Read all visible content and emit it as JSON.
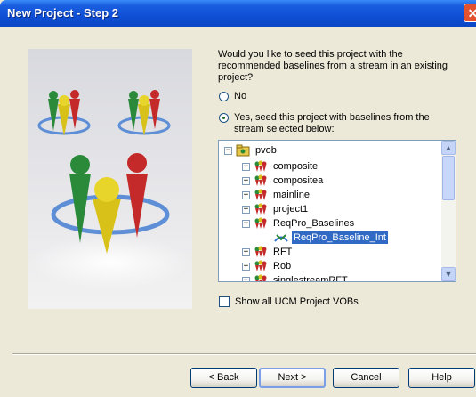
{
  "window": {
    "title": "New Project - Step 2",
    "close_glyph": "✕"
  },
  "prompt": {
    "text": "Would you like to seed this project with the recommended baselines from a stream in an existing project?"
  },
  "options": {
    "no_label": "No",
    "yes_label": "Yes, seed this project with baselines from the stream selected below:",
    "selected": "yes"
  },
  "tree": {
    "root": "pvob",
    "items": [
      {
        "label": "composite"
      },
      {
        "label": "compositea"
      },
      {
        "label": "mainline"
      },
      {
        "label": "project1"
      },
      {
        "label": "ReqPro_Baselines"
      },
      {
        "label": "ReqPro_Baseline_Int"
      },
      {
        "label": "RFT"
      },
      {
        "label": "Rob"
      },
      {
        "label": "singlestreamRFT"
      }
    ],
    "selected_item": "ReqPro_Baseline_Int"
  },
  "checkbox": {
    "label": "Show all UCM Project VOBs",
    "checked": false
  },
  "buttons": {
    "back": "< Back",
    "next": "Next >",
    "cancel": "Cancel",
    "help": "Help"
  },
  "icons": {
    "root": "vob-folder-icon",
    "project": "project-icon",
    "stream": "stream-icon",
    "expander_plus": "+",
    "expander_minus": "−"
  }
}
